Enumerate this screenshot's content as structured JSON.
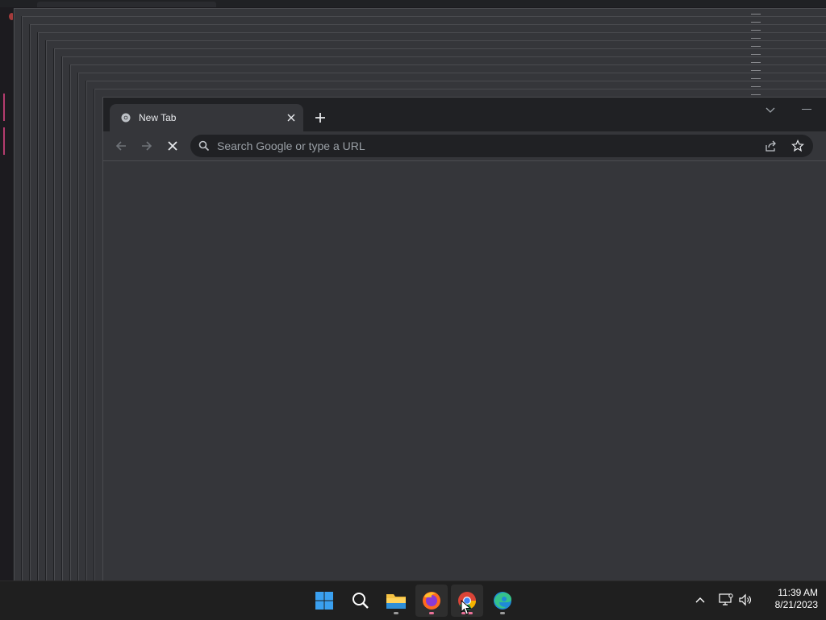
{
  "browser": {
    "tab": {
      "title": "New Tab"
    },
    "omnibox": {
      "placeholder": "Search Google or type a URL",
      "value": ""
    }
  },
  "taskbar": {
    "apps": [
      {
        "name": "Start",
        "icon": "windows-start-icon",
        "active": false
      },
      {
        "name": "Search",
        "icon": "search-icon",
        "active": false
      },
      {
        "name": "File Explorer",
        "icon": "folder-icon",
        "active": false,
        "running": true
      },
      {
        "name": "Firefox",
        "icon": "firefox-icon",
        "active": true,
        "running": true
      },
      {
        "name": "Google Chrome",
        "icon": "chrome-icon",
        "active": true,
        "running": true
      },
      {
        "name": "Microsoft Edge",
        "icon": "edge-icon",
        "active": false,
        "running": true
      }
    ],
    "clock": {
      "time": "11:39 AM",
      "date": "8/21/2023"
    }
  },
  "colors": {
    "desktop": "#1c1b1f",
    "window": "#35363a",
    "tabstrip": "#202124",
    "taskbar": "#1f1f1f",
    "accent_running": "#ea7198"
  }
}
